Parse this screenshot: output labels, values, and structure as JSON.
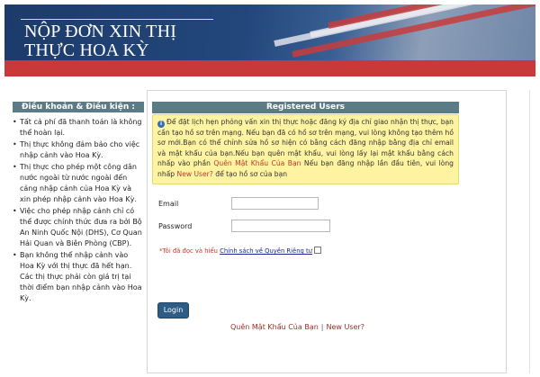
{
  "header": {
    "title_line1": "NỘP ĐƠN XIN THỊ",
    "title_line2": "THỰC HOA KỲ"
  },
  "sidebar": {
    "heading": "Điều khoản & Điều kiện :",
    "items": [
      {
        "label": "Tất cả phí đã thanh toán là không thể hoàn lại."
      },
      {
        "label": "Thị thực không đảm bảo cho việc nhập cảnh vào Hoa Kỳ."
      },
      {
        "label": "Thị thực cho phép một công dân nước ngoài từ nước ngoài đến cảng nhập cảnh của Hoa Kỳ và xin phép nhập cảnh vào Hoa Kỳ."
      },
      {
        "label": "Việc cho phép nhập cảnh chỉ có thể được chính thức đưa ra bởi Bộ An Ninh Quốc Nội (DHS), Cơ Quan Hải Quan và Biên Phòng (CBP)."
      },
      {
        "label": "Bạn không thể nhập cảnh vào Hoa Kỳ với thị thực đã hết hạn. Các thị thực phải còn giá trị tại thời điểm bạn nhập cảnh vào Hoa Kỳ."
      }
    ]
  },
  "main": {
    "heading": "Registered Users",
    "notice": {
      "icon": "info-icon",
      "text_part1": "Để đặt lịch hẹn phỏng vấn xin thị thực hoặc đăng ký địa chỉ giao nhận thị thực, bạn cần tạo hồ sơ trên mạng. Nếu bạn đã có hồ sơ trên mạng, vui lòng không tạo thêm hồ sơ mới.Bạn có thể chỉnh sửa hồ sơ hiện có bằng cách đăng nhập bằng địa chỉ email và mật khẩu của bạn.Nếu bạn quên mật khẩu, vui lòng lấy lại mật khẩu bằng cách nhấp vào phần ",
      "forgot_link": "Quên Mật Khẩu Của Bạn",
      "text_part2": " Nếu bạn đăng nhập lần đầu tiên, vui lòng nhấp ",
      "new_user_link": "New User?",
      "text_part3": " để tạo hồ sơ của bạn"
    },
    "email_label": "Email",
    "email_value": "",
    "password_label": "Password",
    "password_value": "",
    "privacy": {
      "required_mark": "*",
      "prefix": "Tôi đã đọc và hiểu ",
      "link": "Chính sách về Quyền Riêng tư",
      "checked": false
    },
    "login_button": "Login",
    "forgot_password_link": "Quên Mật Khẩu Của Bạn",
    "separator": "|",
    "new_user_link": "New User?"
  },
  "colors": {
    "banner_blue": "#23477c",
    "banner_red": "#c9393a",
    "heading_bg": "#5b7b86",
    "notice_bg": "#fdf3a0",
    "button_bg": "#2e5c85",
    "link_red": "#a02d26"
  }
}
